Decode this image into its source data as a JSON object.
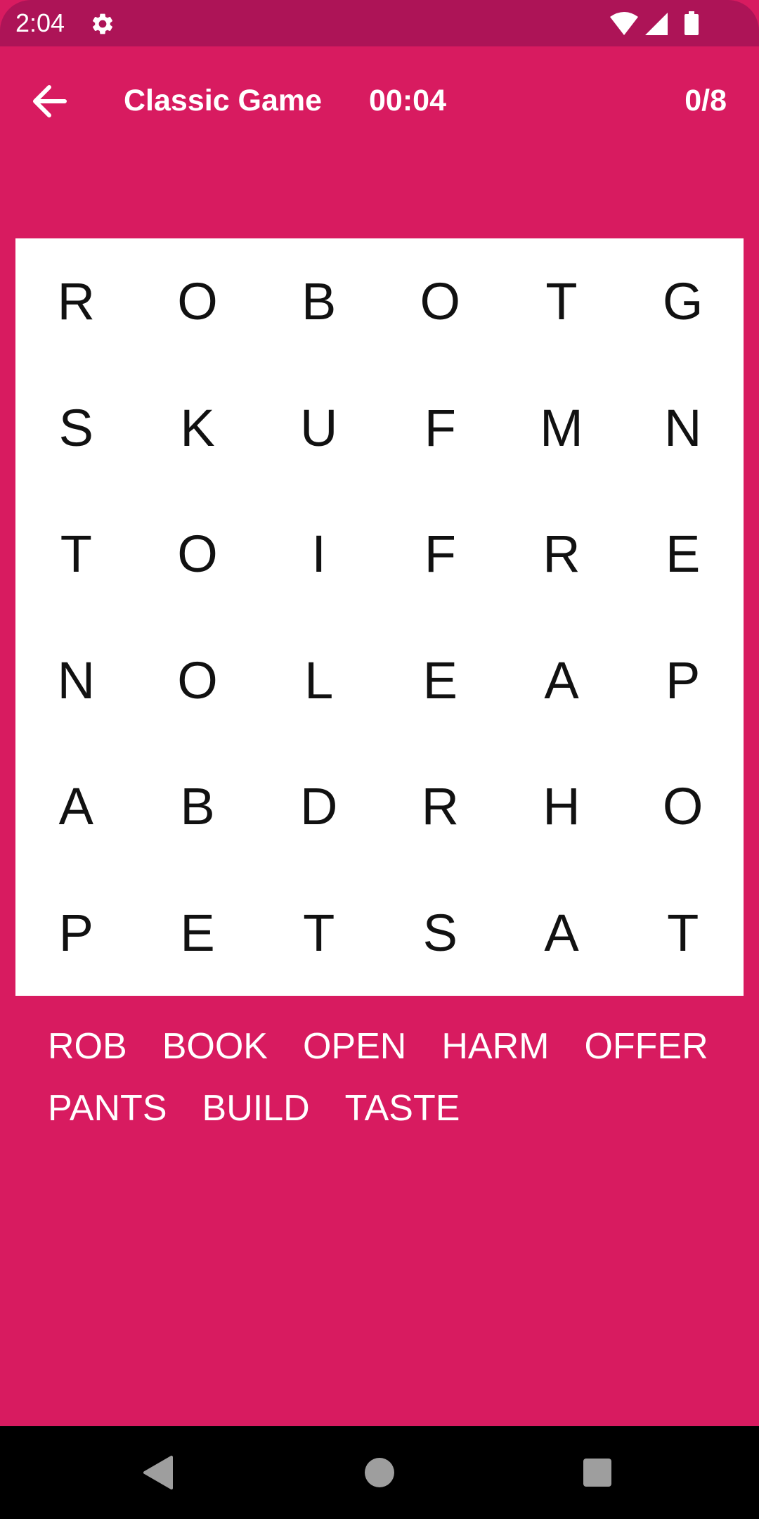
{
  "status_bar": {
    "time": "2:04",
    "icons": [
      "gear-icon",
      "wifi-icon",
      "signal-icon",
      "battery-icon"
    ]
  },
  "toolbar": {
    "back_icon": "arrow-left-icon",
    "title": "Classic Game",
    "timer": "00:04",
    "progress": "0/8"
  },
  "grid": {
    "rows": [
      [
        "R",
        "O",
        "B",
        "O",
        "T",
        "G"
      ],
      [
        "S",
        "K",
        "U",
        "F",
        "M",
        "N"
      ],
      [
        "T",
        "O",
        "I",
        "F",
        "R",
        "E"
      ],
      [
        "N",
        "O",
        "L",
        "E",
        "A",
        "P"
      ],
      [
        "A",
        "B",
        "D",
        "R",
        "H",
        "O"
      ],
      [
        "P",
        "E",
        "T",
        "S",
        "A",
        "T"
      ]
    ]
  },
  "words": [
    [
      "ROB",
      "BOOK",
      "OPEN",
      "HARM",
      "OFFER"
    ],
    [
      "PANTS",
      "BUILD",
      "TASTE"
    ]
  ],
  "nav_bar": {
    "buttons": [
      "back-triangle-icon",
      "home-circle-icon",
      "recents-square-icon"
    ]
  },
  "colors": {
    "background": "#d81b60",
    "status_bar": "#ad1457",
    "grid_background": "#ffffff",
    "letter": "#111111",
    "text_on_primary": "#ffffff",
    "nav_bar": "#000000"
  }
}
